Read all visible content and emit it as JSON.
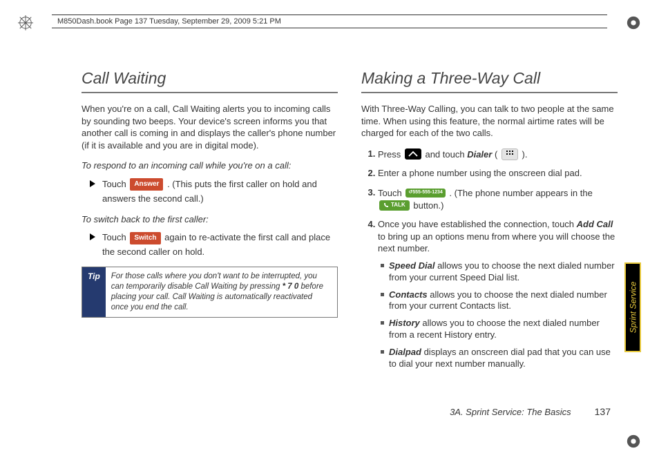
{
  "header": {
    "crop_line": "M850Dash.book  Page 137  Tuesday, September 29, 2009  5:21 PM"
  },
  "left": {
    "title": "Call Waiting",
    "intro": "When you're on a call, Call Waiting alerts you to incoming calls by sounding two beeps. Your device's screen informs you that another call is coming in and displays the caller's phone number (if it is available and you are in digital mode).",
    "sub1": "To respond to an incoming call while you're on a call:",
    "bullet1_a": "Touch ",
    "answer_label": "Answer",
    "bullet1_b": ". (This puts the first caller on hold and answers the second call.)",
    "sub2": "To switch back to the first caller:",
    "bullet2_a": "Touch ",
    "switch_label": "Switch",
    "bullet2_b": " again to re-activate the first call and place the second caller on hold.",
    "tip_label": "Tip",
    "tip_a": "For those calls where you don't want to be interrupted, you can temporarily disable Call Waiting by pressing ",
    "tip_code": "* 7 0",
    "tip_b": " before placing your call. Call Waiting is automatically reactivated once you end the call."
  },
  "right": {
    "title": "Making a Three-Way Call",
    "intro": "With Three-Way Calling, you can talk to two people at the same time. When using this feature, the normal airtime rates will be charged for each of the two calls.",
    "step1_a": "Press ",
    "step1_b": " and touch ",
    "dialer": "Dialer",
    "step1_c": " ( ",
    "step1_d": " ).",
    "step2": "Enter a phone number using the onscreen dial pad.",
    "step3_a": "Touch ",
    "sample_number": "555-555-1234",
    "step3_b": ". (The phone number appears in the ",
    "talk": "TALK",
    "step3_c": " button.)",
    "step4_a": "Once you have established the connection, touch ",
    "addcall": "Add Call",
    "step4_b": " to bring up an options menu from where you will choose the next number.",
    "sb": [
      {
        "label": "Speed Dial",
        "text": " allows you to choose the next dialed number from your current Speed Dial list."
      },
      {
        "label": "Contacts",
        "text": " allows you to choose the next dialed number from your current Contacts list."
      },
      {
        "label": "History",
        "text": " allows you to choose the next dialed number from a recent History entry."
      },
      {
        "label": "Dialpad",
        "text": " displays an onscreen dial pad that you can use to dial your next number manually."
      }
    ]
  },
  "side_tab": "Sprint Service",
  "footer": {
    "section": "3A. Sprint Service: The Basics",
    "page": "137"
  }
}
